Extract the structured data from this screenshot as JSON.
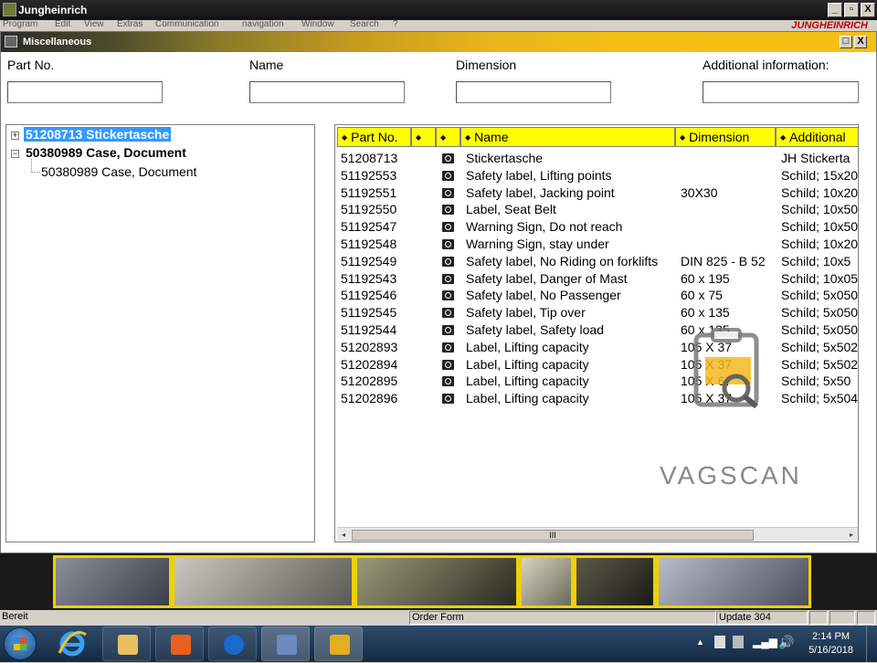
{
  "app": {
    "title": "Jungheinrich",
    "brand": "JUNGHEINRICH",
    "menu": [
      "Program",
      "Edit",
      "View",
      "Extras",
      "Communication",
      "navigation",
      "Window",
      "Search",
      "?"
    ],
    "controls": {
      "minimize": "_",
      "restore": "▫",
      "close": "X"
    }
  },
  "child": {
    "title": "Miscellaneous",
    "controls": {
      "restore": "□",
      "close": "X"
    }
  },
  "search": {
    "part_no_label": "Part No.",
    "name_label": "Name",
    "dimension_label": "Dimension",
    "additional_label": "Additional information:",
    "part_no_value": "",
    "name_value": "",
    "dimension_value": "",
    "additional_value": ""
  },
  "tree": {
    "nodes": [
      {
        "label": "51208713 Stickertasche",
        "expander": "+"
      },
      {
        "label": "50380989 Case, Document",
        "expander": "−"
      },
      {
        "label": "50380989 Case, Document"
      }
    ]
  },
  "grid": {
    "headers": [
      "Part No.",
      "",
      "",
      "Name",
      "Dimension",
      "Additional"
    ],
    "rows": [
      {
        "part": "51208713",
        "name": "Stickertasche",
        "dim": "",
        "add": "JH Stickerta"
      },
      {
        "part": "51192553",
        "name": "Safety label, Lifting points",
        "dim": "",
        "add": "Schild; 15x20"
      },
      {
        "part": "51192551",
        "name": "Safety label, Jacking point",
        "dim": "30X30",
        "add": "Schild; 10x20"
      },
      {
        "part": "51192550",
        "name": "Label, Seat Belt",
        "dim": "",
        "add": "Schild; 10x50"
      },
      {
        "part": "51192547",
        "name": "Warning Sign, Do not reach",
        "dim": "",
        "add": "Schild; 10x50"
      },
      {
        "part": "51192548",
        "name": "Warning Sign, stay under",
        "dim": "",
        "add": "Schild; 10x20"
      },
      {
        "part": "51192549",
        "name": "Safety label, No Riding on forklifts",
        "dim": "DIN 825 - B 52",
        "add": "Schild; 10x5"
      },
      {
        "part": "51192543",
        "name": "Safety label, Danger of Mast",
        "dim": "60 x 195",
        "add": "Schild; 10x05"
      },
      {
        "part": "51192546",
        "name": "Safety label, No Passenger",
        "dim": "60 x 75",
        "add": "Schild; 5x050"
      },
      {
        "part": "51192545",
        "name": "Safety label, Tip over",
        "dim": "60 x 135",
        "add": "Schild; 5x050"
      },
      {
        "part": "51192544",
        "name": "Safety label, Safety load",
        "dim": "60 x 135",
        "add": "Schild; 5x050"
      },
      {
        "part": "51202893",
        "name": "Label, Lifting capacity",
        "dim": "105 X 37",
        "add": "Schild; 5x502"
      },
      {
        "part": "51202894",
        "name": "Label, Lifting capacity",
        "dim": "105 X 37",
        "add": "Schild; 5x502"
      },
      {
        "part": "51202895",
        "name": "Label, Lifting capacity",
        "dim": "105 X 67",
        "add": "Schild; 5x50"
      },
      {
        "part": "51202896",
        "name": "Label, Lifting capacity",
        "dim": "105 X 37",
        "add": "Schild; 5x504"
      }
    ],
    "scroll_grip": "III"
  },
  "watermark": {
    "text": "VAGSCAN"
  },
  "status": {
    "left": "Bereit",
    "middle": "Order Form",
    "right": "Update 304"
  },
  "taskbar": {
    "time": "2:14 PM",
    "date": "5/16/2018"
  },
  "colors": {
    "header_yellow": "#ffff00",
    "selection_blue": "#3399ff",
    "title_gold": "#f3bf14"
  }
}
